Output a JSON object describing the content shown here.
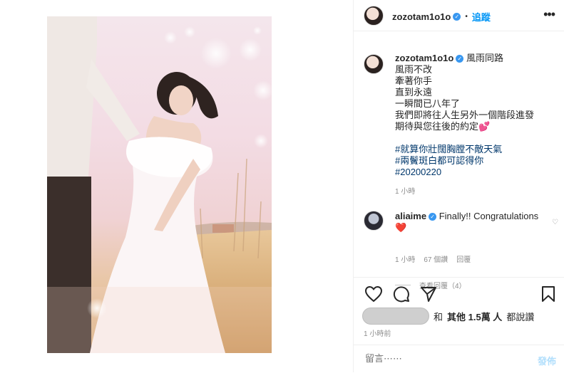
{
  "header": {
    "username": "zozotam1o1o",
    "separator": "•",
    "follow_label": "追蹤",
    "more_label": "•••"
  },
  "caption": {
    "username": "zozotam1o1o",
    "lines": [
      "風雨同路",
      "風雨不改",
      "牽著你手",
      "直到永遠",
      "一瞬間已八年了",
      "我們即將往人生另外一個階段進發",
      "期待與您往後的約定💕"
    ],
    "hashtags": [
      "#就算你壯闊胸膛不敵天氣",
      "#兩鬢斑白都可認得你",
      "#20200220"
    ],
    "time": "1 小時"
  },
  "comment": {
    "username": "aliaime",
    "text": "Finally!! Congratulations ❤️",
    "time": "1 小時",
    "likes": "67 個讚",
    "reply_label": "回覆",
    "view_replies": "查看回覆（4）"
  },
  "likes": {
    "and": "和",
    "others": "其他 1.5萬 人",
    "said": "都說讚"
  },
  "post_time": "1 小時前",
  "comment_box": {
    "placeholder": "留言⋯⋯",
    "post_label": "發佈"
  },
  "colors": {
    "accent": "#0095f6",
    "verified": "#3897f0",
    "hashtag": "#00376b",
    "muted": "#8e8e8e"
  }
}
